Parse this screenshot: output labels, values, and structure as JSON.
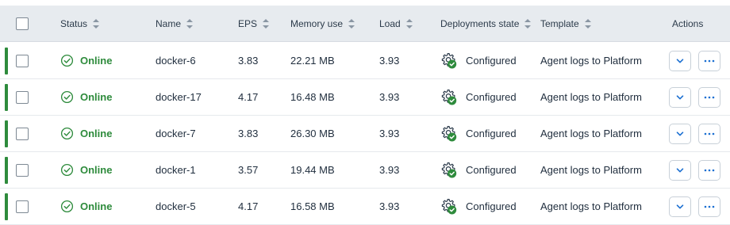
{
  "header": {
    "status": "Status",
    "name": "Name",
    "eps": "EPS",
    "memory": "Memory use",
    "load": "Load",
    "deployments": "Deployments state",
    "template": "Template",
    "actions": "Actions"
  },
  "colors": {
    "online": "#2e8b3c",
    "row_bar": "#2e8b3c",
    "header_bg": "#e7ebef",
    "chevron": "#1b6fd1"
  },
  "rows": [
    {
      "status": "Online",
      "name": "docker-6",
      "eps": "3.83",
      "memory": "22.21 MB",
      "load": "3.93",
      "deployment": "Configured",
      "template": "Agent logs to Platform"
    },
    {
      "status": "Online",
      "name": "docker-17",
      "eps": "4.17",
      "memory": "16.48 MB",
      "load": "3.93",
      "deployment": "Configured",
      "template": "Agent logs to Platform"
    },
    {
      "status": "Online",
      "name": "docker-7",
      "eps": "3.83",
      "memory": "26.30 MB",
      "load": "3.93",
      "deployment": "Configured",
      "template": "Agent logs to Platform"
    },
    {
      "status": "Online",
      "name": "docker-1",
      "eps": "3.57",
      "memory": "19.44 MB",
      "load": "3.93",
      "deployment": "Configured",
      "template": "Agent logs to Platform"
    },
    {
      "status": "Online",
      "name": "docker-5",
      "eps": "4.17",
      "memory": "16.58 MB",
      "load": "3.93",
      "deployment": "Configured",
      "template": "Agent logs to Platform"
    }
  ],
  "icons": {
    "status": "check-circle-icon",
    "deployment": "gear-check-icon",
    "expand": "chevron-down-icon",
    "more": "more-dots-icon"
  }
}
